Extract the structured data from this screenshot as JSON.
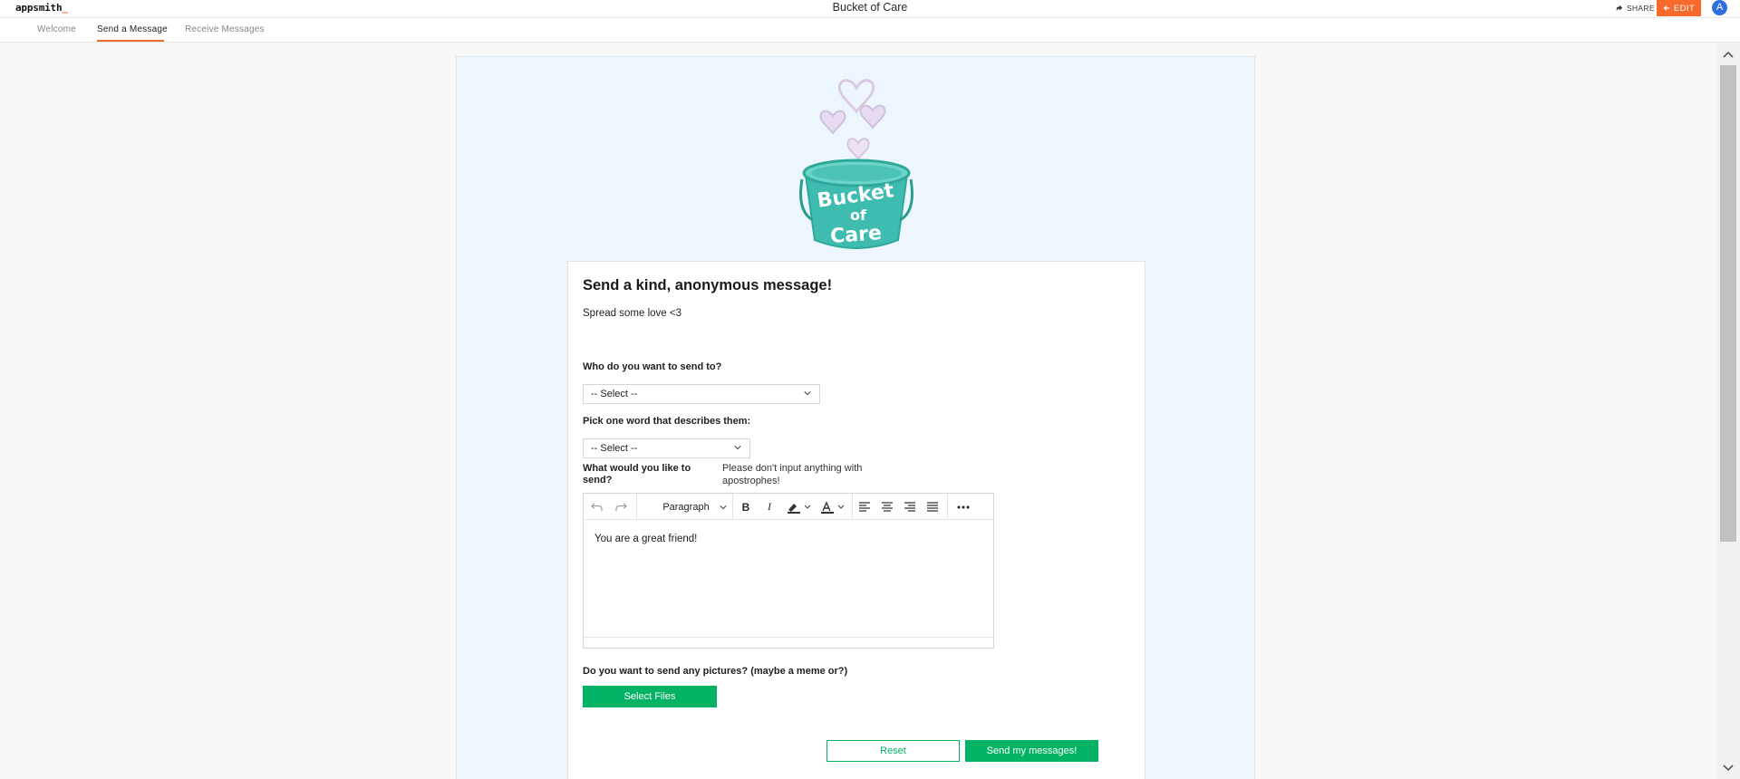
{
  "header": {
    "logo": "appsmith",
    "logo_cursor": "_",
    "title": "Bucket of Care",
    "share_label": "SHARE",
    "edit_label": "EDIT",
    "avatar_initial": "A"
  },
  "tabs": [
    {
      "label": "Welcome",
      "active": false
    },
    {
      "label": "Send a Message",
      "active": true
    },
    {
      "label": "Receive Messages",
      "active": false
    }
  ],
  "logo_image": {
    "lines": [
      "Bucket",
      "of",
      "Care"
    ],
    "colors": {
      "bucket": "#3fbcb0",
      "rim": "#2ea89a",
      "hearts": "#d9cbe3",
      "text": "#ffffff"
    }
  },
  "form": {
    "heading": "Send a kind, anonymous message!",
    "subheading": "Spread some love <3",
    "recipient": {
      "label": "Who do you want to send to?",
      "value": "-- Select --"
    },
    "descriptor": {
      "label": "Pick one word that describes them:",
      "value": "-- Select --"
    },
    "message": {
      "label": "What would you like to send?",
      "note": "Please don't input anything with apostrophes!",
      "block_format": "Paragraph",
      "content": "You are a great friend!"
    },
    "pictures": {
      "label": "Do you want to send any pictures? (maybe a meme or?)",
      "button": "Select Files"
    },
    "reset_label": "Reset",
    "submit_label": "Send my messages!"
  },
  "colors": {
    "accent": "#f86a2b",
    "primary": "#03b365",
    "canvas": "#eef6fd",
    "avatar": "#2f6fdf"
  }
}
